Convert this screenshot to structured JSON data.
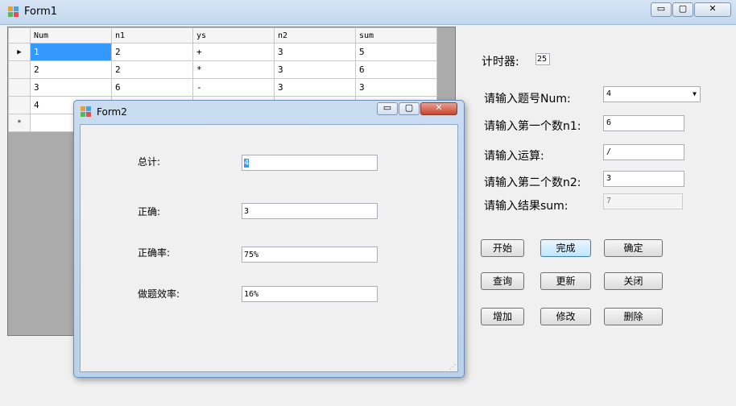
{
  "form1": {
    "title": "Form1",
    "grid": {
      "columns": [
        "Num",
        "n1",
        "ys",
        "n2",
        "sum"
      ],
      "rows": [
        [
          "1",
          "2",
          "+",
          "3",
          "5"
        ],
        [
          "2",
          "2",
          "*",
          "3",
          "6"
        ],
        [
          "3",
          "6",
          "-",
          "3",
          "3"
        ],
        [
          "4",
          "",
          "",
          "",
          ""
        ]
      ],
      "new_row_marker": "*",
      "current_row_marker": "▶"
    },
    "timer": {
      "label": "计时器:",
      "value": "25"
    },
    "fields": [
      {
        "label": "请输入题号Num:",
        "value": "4",
        "type": "select"
      },
      {
        "label": "请输入第一个数n1:",
        "value": "6"
      },
      {
        "label": "请输入运算:",
        "value": "/"
      },
      {
        "label": "请输入第二个数n2:",
        "value": "3"
      },
      {
        "label": "请输入结果sum:",
        "value": "7",
        "disabled": true
      }
    ],
    "buttons": {
      "start": "开始",
      "finish": "完成",
      "confirm": "确定",
      "query": "查询",
      "update": "更新",
      "close": "关闭",
      "add": "增加",
      "modify": "修改",
      "delete": "删除"
    }
  },
  "form2": {
    "title": "Form2",
    "total_label": "总计:",
    "total_value": "4",
    "correct_label": "正确:",
    "correct_value": "3",
    "rate_label": "正确率:",
    "rate_value": "75%",
    "efficiency_label": "做题效率:",
    "efficiency_value": "16%"
  },
  "window_controls": {
    "minimize": "▭",
    "maximize": "▢",
    "close": "✕"
  }
}
